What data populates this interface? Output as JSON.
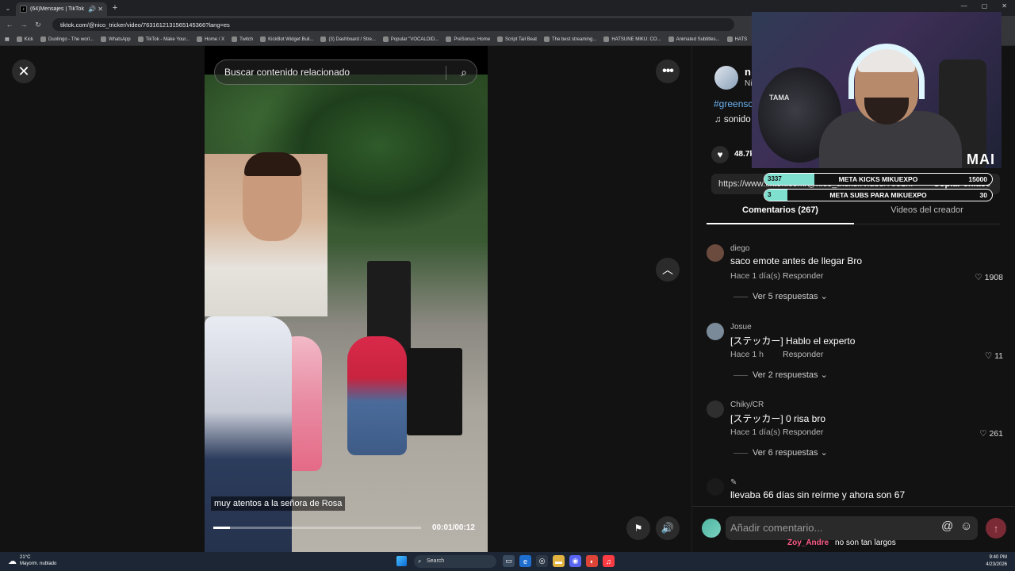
{
  "browser": {
    "tab_title": "(64)Mensajes | TikTok",
    "url": "tiktok.com/@nico_tricker/video/7631612131565145366?lang=es",
    "bookmarks": [
      "Kick",
      "Duolingo - The worl...",
      "WhatsApp",
      "TikTok - Make Your...",
      "Home / X",
      "Twitch",
      "KickBot Widget Buil...",
      "(3) Dashboard / Stre...",
      "Popular \"VOCALOID...",
      "PreSonus: Home",
      "Script Tail Beat",
      "The best streaming...",
      "HATSUNE MIKU: CO...",
      "Animated Subtitles...",
      "HATS"
    ]
  },
  "video": {
    "search_placeholder": "Buscar contenido relacionado",
    "caption": "muy atentos a la señora de Rosa",
    "timecode": "00:01/00:12",
    "progress_percent": 8
  },
  "creator": {
    "name": "n",
    "subname": "Ni",
    "hashtag": "#greensc",
    "sound": "♫  sonido"
  },
  "stats": {
    "likes": "48.7k"
  },
  "link": {
    "url": "https://www.tiktok.com/@nico_tricker/video/7631...",
    "copy_label": "Copiar enlace"
  },
  "tabs": {
    "comments": "Comentarios (267)",
    "creator_videos": "Videos del creador"
  },
  "comments": [
    {
      "user": "diego",
      "text": "saco emote antes de llegar Bro",
      "time": "Hace 1 día(s)",
      "reply": "Responder",
      "likes": "♡ 1908",
      "more": "Ver 5 respuestas ⌄"
    },
    {
      "user": "Josue",
      "text": "[ステッカー] Hablo el experto",
      "time": "Hace 1 h",
      "reply": "Responder",
      "likes": "♡ 11",
      "more": "Ver 2 respuestas ⌄"
    },
    {
      "user": "Chiky/CR",
      "text": "[ステッカー] 0 risa bro",
      "time": "Hace 1 día(s)",
      "reply": "Responder",
      "likes": "♡ 261",
      "more": "Ver 6 respuestas ⌄"
    },
    {
      "user": "✎",
      "text": "llevaba 66 días sin reírme y ahora son 67",
      "time": "",
      "reply": "",
      "likes": "",
      "more": ""
    }
  ],
  "add_comment": {
    "placeholder": "Añadir comentario..."
  },
  "overlay": {
    "logo": "MAI",
    "drum_brand": "TAMA",
    "goals": [
      {
        "current": "3337",
        "title": "META KICKS MIKUEXPO",
        "max": "15000",
        "fill_fraction": 0.22
      },
      {
        "current": "3",
        "title": "META SUBS PARA MIKUEXPO",
        "max": "30",
        "fill_fraction": 0.1
      }
    ],
    "chat": {
      "user": "Zoy_Andre",
      "message": "no son tan largos"
    }
  },
  "taskbar": {
    "weather_temp": "21°C",
    "weather_desc": "Mayorm. nublado",
    "search": "Search",
    "time": "9:40 PM",
    "date": "4/23/2026"
  }
}
